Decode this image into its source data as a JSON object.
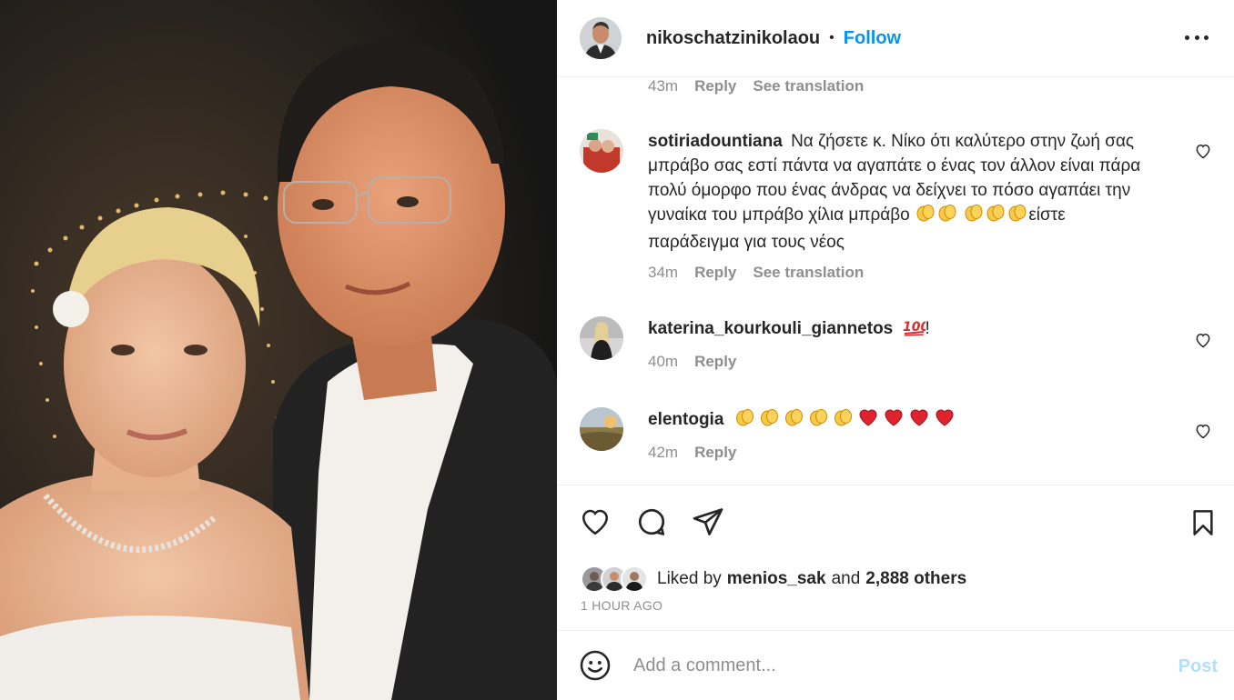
{
  "post": {
    "username": "nikoschatzinikolaou",
    "separator": "•",
    "follow_label": "Follow",
    "more_icon": "more-horizontal-icon"
  },
  "top_meta": {
    "time": "43m",
    "reply_label": "Reply",
    "translation_label": "See translation"
  },
  "comments": [
    {
      "username": "sotiriadountiana",
      "text_line_1": "Να ζήσετε κ. Νίκο ότι καλύτερο στην ζωή",
      "text_line_2": "σας μπράβο σας εστί πάντα να αγαπάτε ο ένας τον άλλον",
      "text_line_3": "είναι πάρα πολύ όμορφο που ένας άνδρας να δείχνει το",
      "text_line_4": "πόσο αγαπάει την γυναίκα του μπράβο χίλια μπράβο",
      "text_line_5": "είστε παράδειγμα για τους νέος",
      "emoji_inline": [
        "clapping-hands",
        "clapping-hands",
        "clapping-hands",
        "clapping-hands",
        "clapping-hands"
      ],
      "time": "34m",
      "reply_label": "Reply",
      "translation_label": "See translation"
    },
    {
      "username": "katerina_kourkouli_giannetos",
      "text_suffix": "!",
      "emoji_inline": [
        "hundred-points"
      ],
      "time": "40m",
      "reply_label": "Reply"
    },
    {
      "username": "elentogia",
      "emoji_inline": [
        "clapping-hands",
        "clapping-hands",
        "clapping-hands",
        "clapping-hands",
        "clapping-hands",
        "red-heart",
        "red-heart",
        "red-heart",
        "red-heart"
      ],
      "time": "42m",
      "reply_label": "Reply"
    }
  ],
  "likes": {
    "prefix": "Liked by",
    "first_liker": "menios_sak",
    "and_label": "and",
    "others": "2,888 others"
  },
  "posted_ago": "1 HOUR AGO",
  "comment_box": {
    "placeholder": "Add a comment...",
    "post_label": "Post"
  },
  "colors": {
    "accent": "#0095f6",
    "post_disabled": "#b2dffc",
    "muted": "#8e8e8e",
    "text": "#262626"
  }
}
